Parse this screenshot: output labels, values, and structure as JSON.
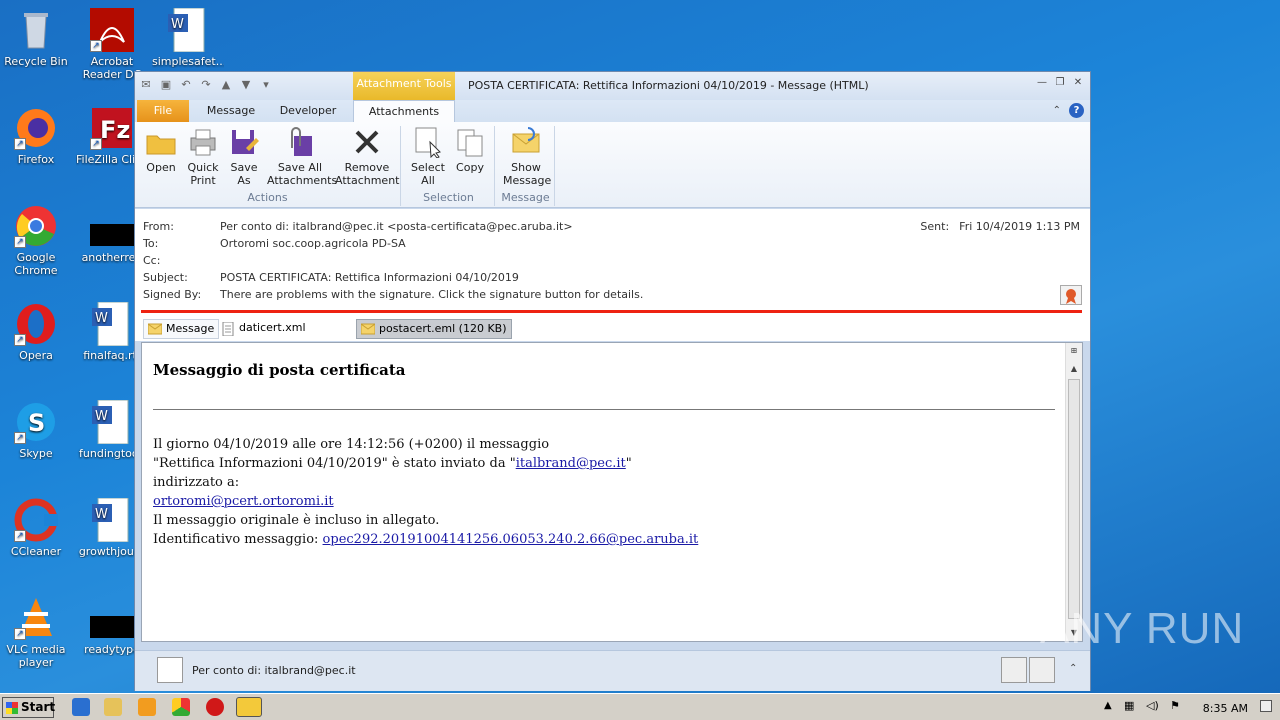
{
  "desktop": {
    "icons": [
      {
        "label": "Recycle Bin",
        "icon": "recycle-bin-icon"
      },
      {
        "label": "Acrobat Reader DC",
        "icon": "acrobat-icon"
      },
      {
        "label": "simplesafet...",
        "icon": "word-doc-icon"
      },
      {
        "label": "Firefox",
        "icon": "firefox-icon"
      },
      {
        "label": "FileZilla Client",
        "icon": "filezilla-icon"
      },
      {
        "label": "Google Chrome",
        "icon": "chrome-icon"
      },
      {
        "label": "anotherreq",
        "icon": "blank-file-icon"
      },
      {
        "label": "Opera",
        "icon": "opera-icon"
      },
      {
        "label": "finalfaq.rtf",
        "icon": "word-doc-icon"
      },
      {
        "label": "Skype",
        "icon": "skype-icon"
      },
      {
        "label": "fundingtook",
        "icon": "word-doc-icon"
      },
      {
        "label": "CCleaner",
        "icon": "ccleaner-icon"
      },
      {
        "label": "growthjourn",
        "icon": "word-doc-icon"
      },
      {
        "label": "VLC media player",
        "icon": "vlc-icon"
      },
      {
        "label": "readytype",
        "icon": "blank-file-icon"
      }
    ]
  },
  "window": {
    "context_tab": "Attachment Tools",
    "title": "POSTA CERTIFICATA: Rettifica Informazioni 04/10/2019 - Message (HTML)",
    "tabs": {
      "file": "File",
      "message": "Message",
      "developer": "Developer",
      "attachments": "Attachments"
    },
    "ribbon": {
      "actions": {
        "label": "Actions",
        "open": "Open",
        "quick_print_1": "Quick",
        "quick_print_2": "Print",
        "save_as_1": "Save",
        "save_as_2": "As",
        "save_all_1": "Save All",
        "save_all_2": "Attachments",
        "remove_1": "Remove",
        "remove_2": "Attachment"
      },
      "selection": {
        "label": "Selection",
        "select_all_1": "Select",
        "select_all_2": "All",
        "copy": "Copy"
      },
      "message": {
        "label": "Message",
        "show_1": "Show",
        "show_2": "Message"
      }
    },
    "header": {
      "from_k": "From:",
      "from_v": "Per conto di: italbrand@pec.it <posta-certificata@pec.aruba.it>",
      "to_k": "To:",
      "to_v": "Ortoromi soc.coop.agricola PD-SA",
      "cc_k": "Cc:",
      "subject_k": "Subject:",
      "subject_v": "POSTA CERTIFICATA: Rettifica Informazioni 04/10/2019",
      "signed_k": "Signed By:",
      "signed_v": "There are problems with the signature. Click the signature button for details.",
      "sent_k": "Sent:",
      "sent_v": "Fri 10/4/2019 1:13 PM"
    },
    "attachments": {
      "message": "Message",
      "daticert": "daticert.xml",
      "postacert": "postacert.eml (120 KB)"
    },
    "body": {
      "heading": "Messaggio di posta certificata",
      "l1": "Il giorno 04/10/2019 alle ore 14:12:56 (+0200) il messaggio",
      "l2a": "\"Rettifica Informazioni 04/10/2019\" è stato inviato da \"",
      "l2link": "italbrand@pec.it",
      "l2b": "\"",
      "l3": "indirizzato a:",
      "l4link": "ortoromi@pcert.ortoromi.it",
      "l5": "Il messaggio originale è incluso in allegato.",
      "l6a": "Identificativo messaggio: ",
      "l6link": "opec292.20191004141256.06053.240.2.66@pec.aruba.it"
    },
    "people_pane": "Per conto di: italbrand@pec.it"
  },
  "taskbar": {
    "start": "Start",
    "clock": "8:35 AM"
  },
  "watermark": "ANY RUN"
}
